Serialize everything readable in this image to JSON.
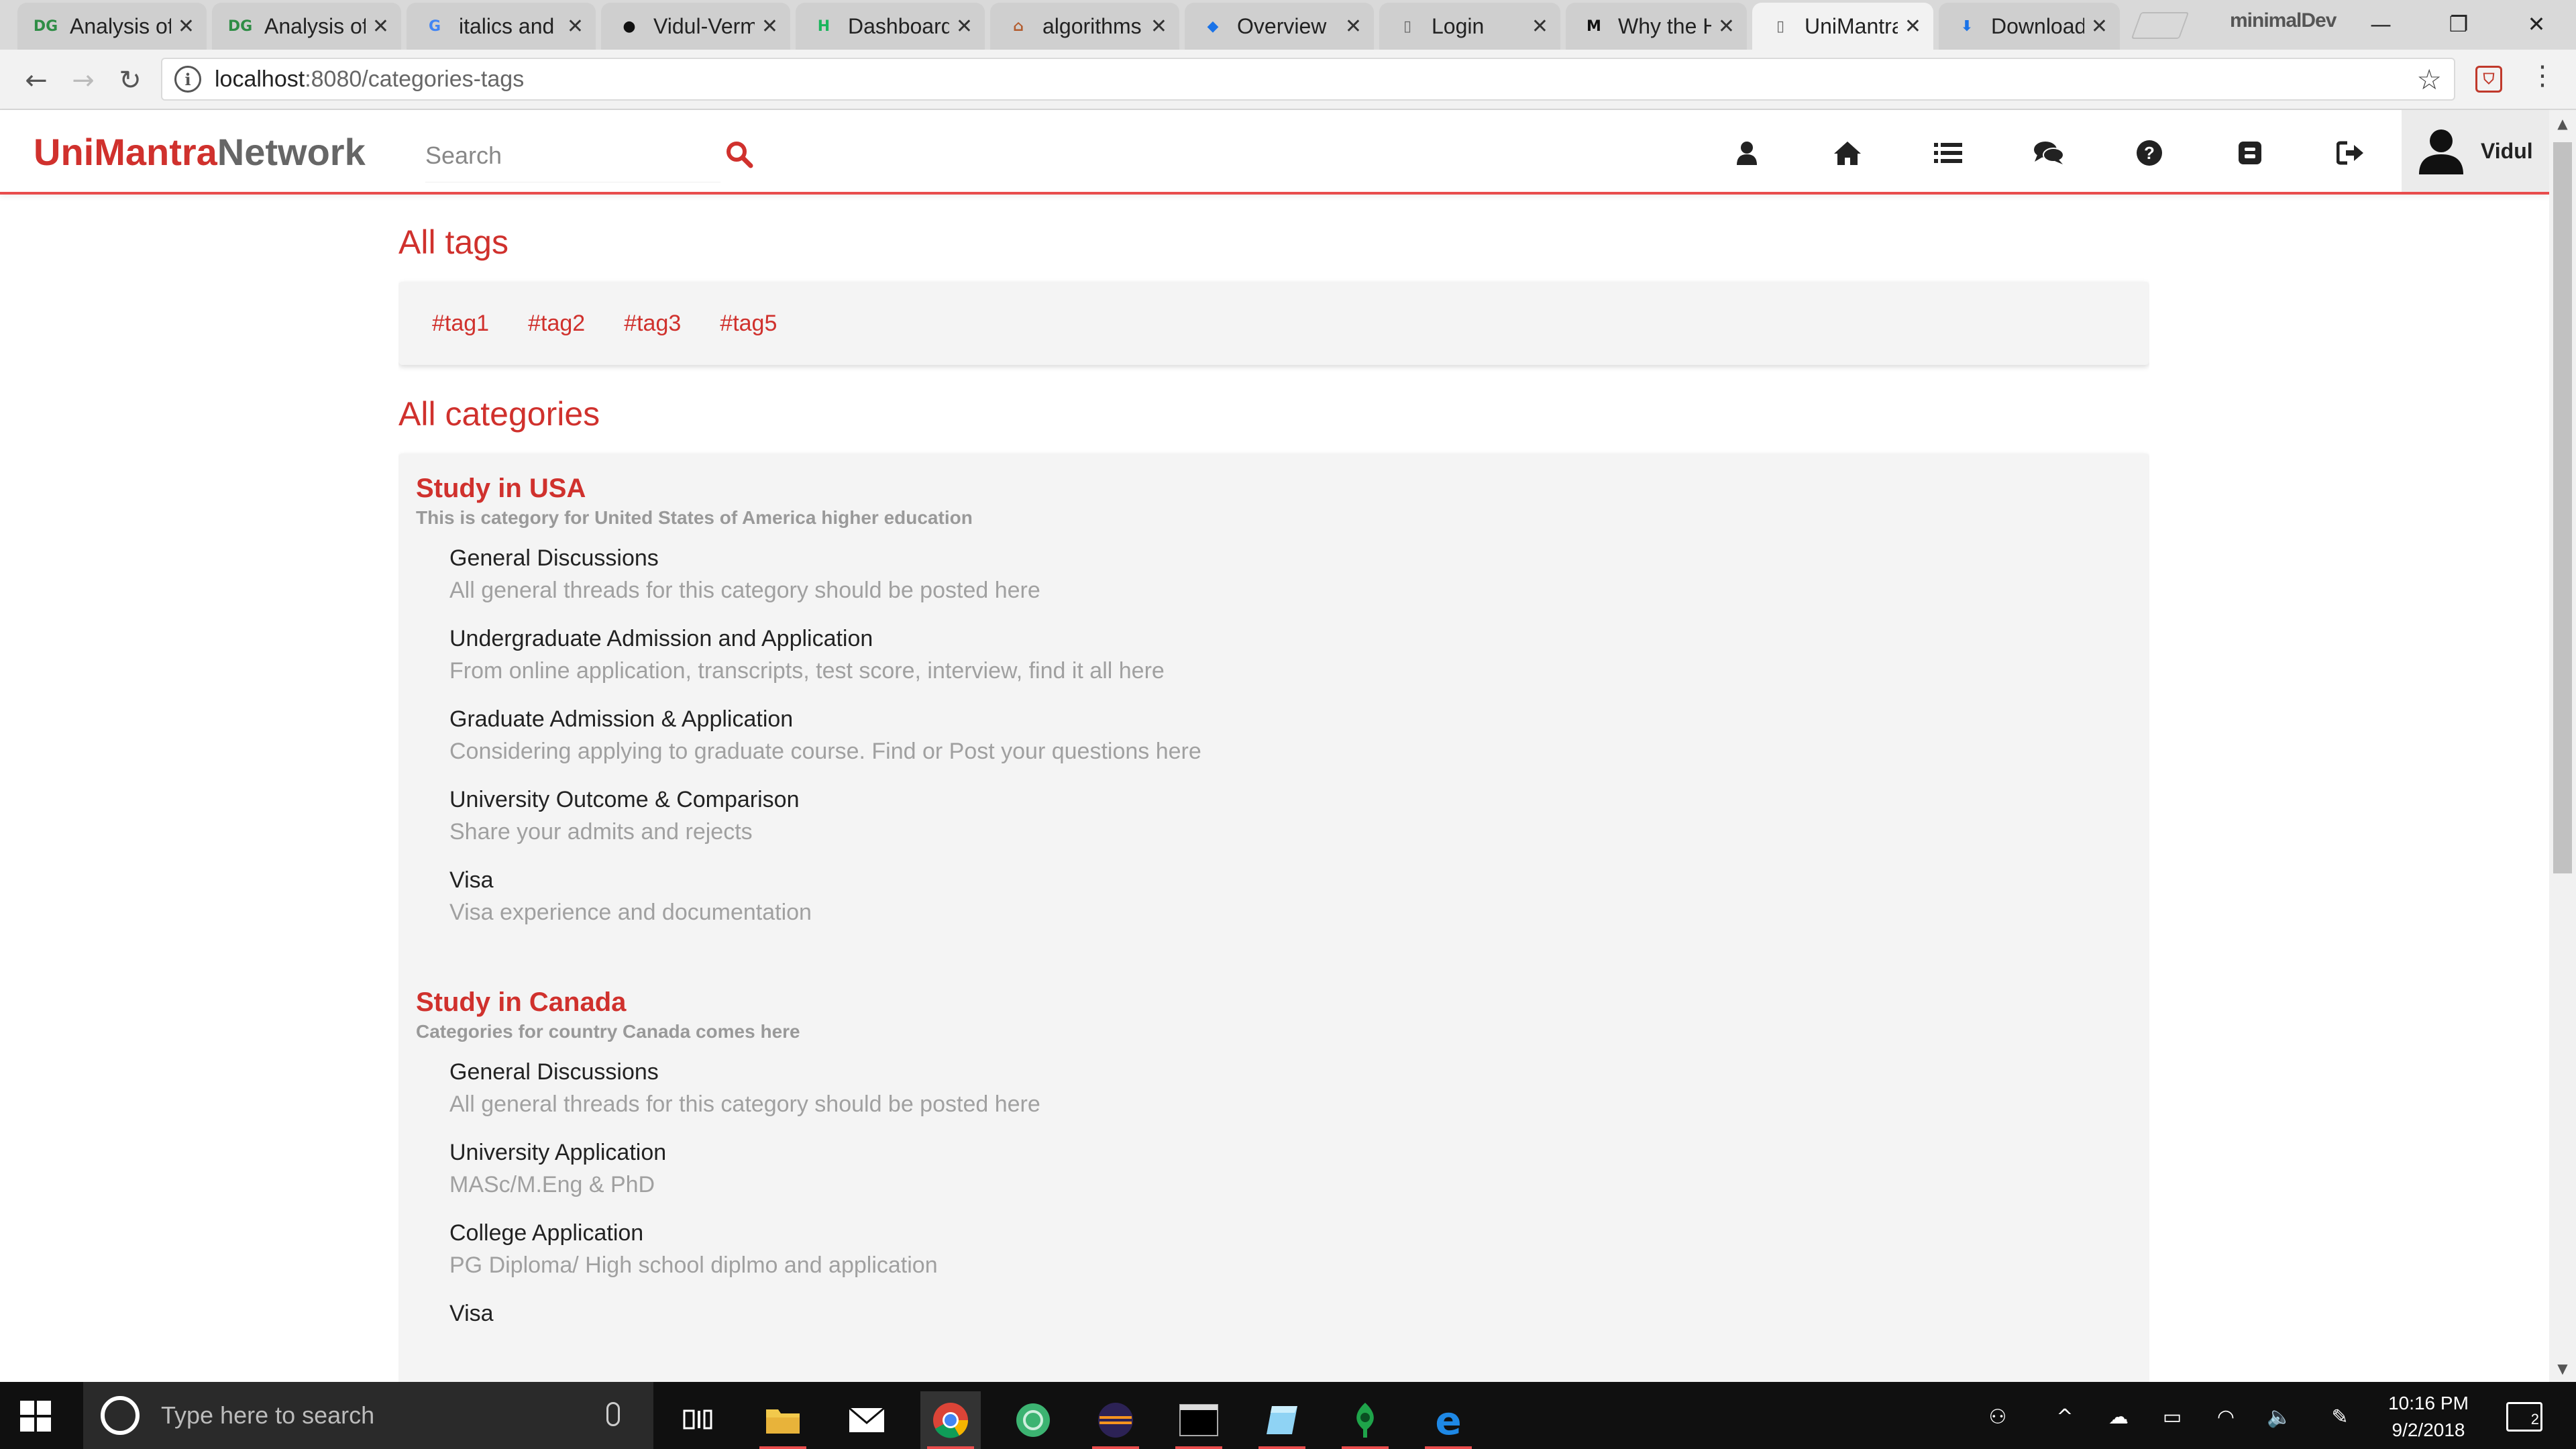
{
  "browser": {
    "tabs": [
      {
        "title": "Analysis of",
        "icon": "geeksforgeeks-icon",
        "glyph": "DG",
        "color": "#2f8d46"
      },
      {
        "title": "Analysis of",
        "icon": "geeksforgeeks-icon",
        "glyph": "DG",
        "color": "#2f8d46"
      },
      {
        "title": "italics and",
        "icon": "google-icon",
        "glyph": "G",
        "color": "#4285f4"
      },
      {
        "title": "Vidul-Verm",
        "icon": "github-icon",
        "glyph": "●",
        "color": "#111111"
      },
      {
        "title": "Dashboard",
        "icon": "heroku-dashboard-icon",
        "glyph": "H",
        "color": "#1bb55c"
      },
      {
        "title": "algorithms",
        "icon": "stackexchange-icon",
        "glyph": "⌂",
        "color": "#b35c2e"
      },
      {
        "title": "Overview",
        "icon": "shield-icon",
        "glyph": "◆",
        "color": "#1a73e8"
      },
      {
        "title": "Login",
        "icon": "page-icon",
        "glyph": "▯",
        "color": "#666666"
      },
      {
        "title": "Why the H",
        "icon": "medium-icon",
        "glyph": "M",
        "color": "#111111"
      },
      {
        "title": "UniMantra",
        "icon": "page-icon",
        "glyph": "▯",
        "color": "#666666"
      },
      {
        "title": "Download",
        "icon": "download-icon",
        "glyph": "⬇",
        "color": "#1a73e8"
      }
    ],
    "close_glyph": "✕",
    "profile_name": "minimalDev",
    "address": {
      "host": "localhost",
      "path": ":8080/categories-tags"
    },
    "info_glyph": "i",
    "star_glyph": "☆",
    "ext_glyph": "⛉",
    "menu_glyph": "⋮",
    "nav": {
      "back": "←",
      "forward": "→",
      "reload": "↻"
    },
    "window": {
      "minimize": "—",
      "restore": "❐",
      "close": "✕"
    }
  },
  "app": {
    "brand_primary": "UniMantra",
    "brand_secondary": "Network",
    "search_placeholder": "Search",
    "nav_icons": [
      "profile-icon",
      "home-icon",
      "list-icon",
      "chat-icon",
      "help-icon",
      "blog-icon",
      "logout-icon"
    ],
    "user_name": "Vidul",
    "accent_color": "#d0312d"
  },
  "tags_section": {
    "heading": "All tags",
    "tags": [
      "#tag1",
      "#tag2",
      "#tag3",
      "#tag5"
    ]
  },
  "categories_section": {
    "heading": "All categories",
    "categories": [
      {
        "title": "Study in USA",
        "description": "This is category for United States of America higher education",
        "subcategories": [
          {
            "name": "General Discussions",
            "description": "All general threads for this category should be posted here"
          },
          {
            "name": "Undergraduate Admission and Application",
            "description": "From online application, transcripts, test score, interview, find it all here"
          },
          {
            "name": "Graduate Admission & Application",
            "description": "Considering applying to graduate course. Find or Post your questions here"
          },
          {
            "name": "University Outcome & Comparison",
            "description": "Share your admits and rejects"
          },
          {
            "name": "Visa",
            "description": "Visa experience and documentation"
          }
        ]
      },
      {
        "title": "Study in Canada",
        "description": "Categories for country Canada comes here",
        "subcategories": [
          {
            "name": "General Discussions",
            "description": "All general threads for this category should be posted here"
          },
          {
            "name": "University Application",
            "description": "MASc/M.Eng & PhD"
          },
          {
            "name": "College Application",
            "description": "PG Diploma/ High school diplmo and application"
          },
          {
            "name": "Visa",
            "description": ""
          }
        ]
      }
    ]
  },
  "scrollbar": {
    "up": "▲",
    "down": "▼"
  },
  "taskbar": {
    "search_placeholder": "Type here to search",
    "apps": [
      "task-view-icon",
      "file-explorer-icon",
      "mail-icon",
      "chrome-icon",
      "app-green-icon",
      "eclipse-icon",
      "terminal-icon",
      "notepad-icon",
      "sourcetree-icon",
      "edge-icon"
    ],
    "tray": {
      "people": "⚇",
      "chevron": "^",
      "cloud": "☁",
      "battery": "▭",
      "wifi": "◠",
      "volume": "🔈",
      "pen": "✎"
    },
    "time": "10:16 PM",
    "date": "9/2/2018",
    "notification_count": "2"
  }
}
